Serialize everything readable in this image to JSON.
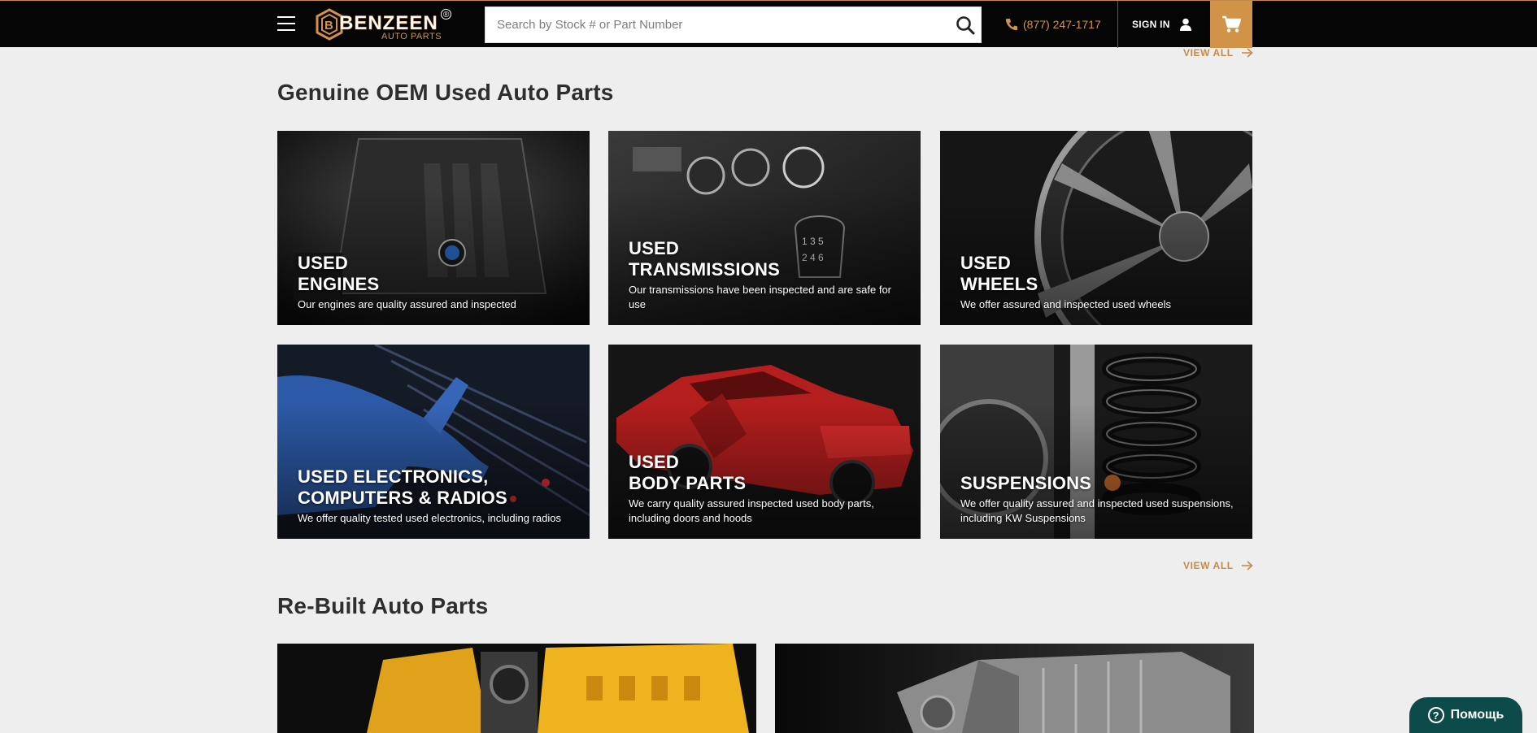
{
  "header": {
    "logo_brand": "BENZEEN",
    "logo_sub": "AUTO PARTS",
    "logo_mark": "®",
    "search_placeholder": "Search by Stock # or Part Number",
    "phone": "(877) 247-1717",
    "signin_label": "SIGN IN"
  },
  "view_all_label": "VIEW ALL",
  "oem_section": {
    "title": "Genuine OEM Used Auto Parts",
    "cards": [
      {
        "title": "USED\nENGINES",
        "desc": "Our engines are quality assured and inspected"
      },
      {
        "title": "USED\nTRANSMISSIONS",
        "desc": "Our transmissions have been inspected and are safe for use"
      },
      {
        "title": "USED\nWHEELS",
        "desc": "We offer assured and inspected used wheels"
      },
      {
        "title": "USED ELECTRONICS,\nCOMPUTERS & RADIOS",
        "desc": "We offer quality tested used electronics, including radios"
      },
      {
        "title": "USED\nBODY PARTS",
        "desc": "We carry quality assured inspected used body parts, including doors and hoods"
      },
      {
        "title": "SUSPENSIONS",
        "desc": "We offer quality assured and inspected used suspensions, including KW Suspensions"
      }
    ]
  },
  "rebuilt_section": {
    "title": "Re-Built Auto Parts"
  },
  "help_widget": {
    "label": "Помощь",
    "icon": "?"
  },
  "colors": {
    "accent": "#d19347",
    "header_bg": "#050505",
    "page_bg": "#eeeeee",
    "help_bg": "#0d4a4a"
  }
}
